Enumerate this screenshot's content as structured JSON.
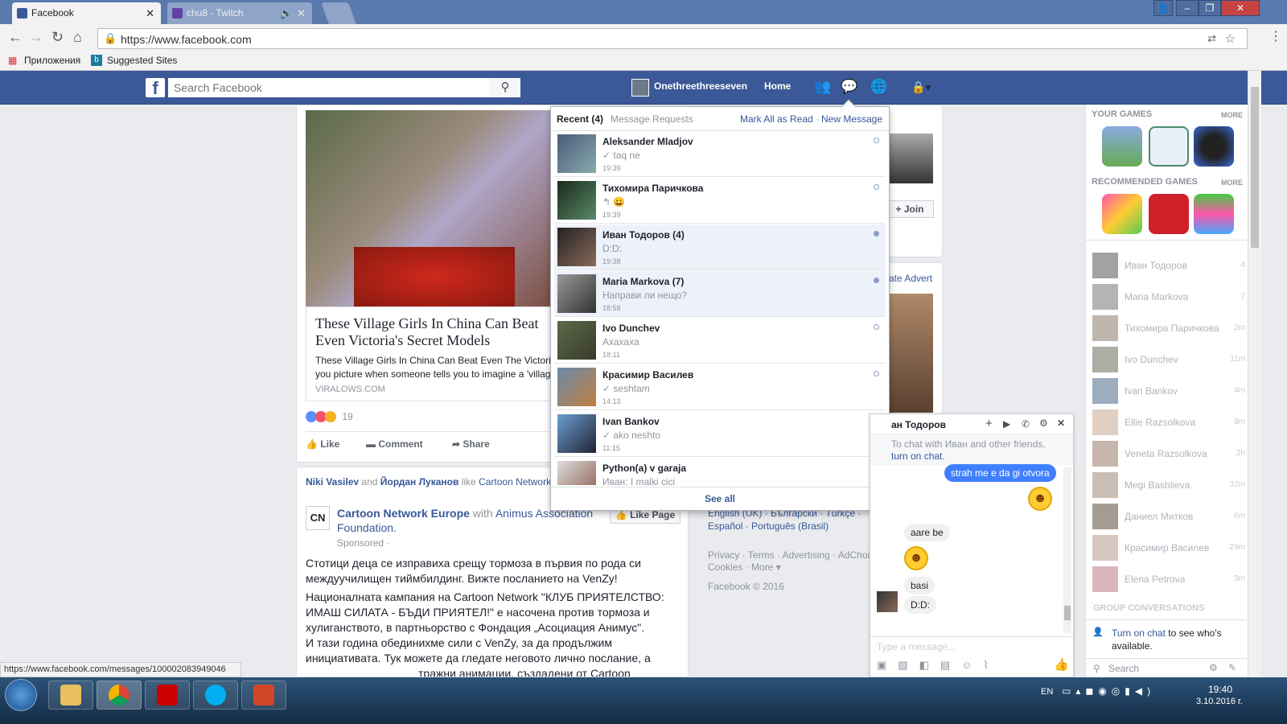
{
  "browser": {
    "tabs": [
      {
        "title": "Facebook",
        "active": true
      },
      {
        "title": "chu8 - Twitch",
        "active": false
      }
    ],
    "url": "https://www.facebook.com",
    "bookmarks": [
      "Приложения",
      "Suggested Sites"
    ],
    "status_url": "https://www.facebook.com/messages/100002083949046"
  },
  "fb_header": {
    "search_placeholder": "Search Facebook",
    "user_name": "Onethreethreeseven",
    "home": "Home"
  },
  "post1": {
    "title": "These Village Girls In China Can Beat Even Victoria's Secret Models",
    "desc_line1": "These Village Girls In China Can Beat Even The Victori",
    "desc_line2": "you picture when someone tells you to imagine a 'villag",
    "source": "VIRALOWS.COM",
    "reactions_count": "19",
    "actions": [
      "Like",
      "Comment",
      "Share"
    ]
  },
  "post2": {
    "liked_by_1": "Niki Vasilev",
    "liked_by_and": "and",
    "liked_by_2": "Йордан Луканов",
    "liked_by_rest": "like",
    "liked_page": "Cartoon Network",
    "page_name": "Cartoon Network Europe",
    "with_text": "with",
    "with_org": "Animus Association Foundation.",
    "sponsored": "Sponsored ·",
    "like_page": "Like Page",
    "text1": "Стотици деца се изправиха срещу тормоза в първия по рода си междуучилищен тиймбилдинг. Вижте посланието на VenZy!",
    "text2": "Националната кампания на Cartoon Network \"КЛУБ ПРИЯТЕЛСТВО: ИМАШ СИЛАТА - БЪДИ ПРИЯТЕЛ!\" е насочена против тормоза и хулиганството, в партньорство с Фондация „Асоциация Анимус\".",
    "text3": "И тази година обединихме сили с VenZy, за да продължим инициативата. Тук можете да гледате неговото лично послание, а",
    "text4": "тражни анимации, създадени от Cartoon Network,"
  },
  "right_feed": {
    "join": "+ Join",
    "create_advert": "ate Advert",
    "languages": "English (UK) · Български · Türkçe · Español · Português (Brasil)",
    "footer1": "Privacy · Terms · Advertising · AdChoi",
    "footer2": "Cookies · More ▾",
    "copyright": "Facebook © 2016"
  },
  "messages": {
    "tab_recent": "Recent (4)",
    "tab_requests": "Message Requests",
    "mark_read": "Mark All as Read",
    "sep": "·",
    "new_message": "New Message",
    "see_all": "See all",
    "threads": [
      {
        "name": "Aleksander Mladjov",
        "snippet": "✓ taq ne",
        "time": "19:39",
        "unread": false
      },
      {
        "name": "Тихомира Паричкова",
        "snippet": "↰ 😀",
        "time": "19:39",
        "unread": false
      },
      {
        "name": "Иван Тодоров (4)",
        "snippet": "D:D:",
        "time": "19:38",
        "unread": true
      },
      {
        "name": "Maria Markova (7)",
        "snippet": "Направи ли нещо?",
        "time": "18:58",
        "unread": true
      },
      {
        "name": "Ivo Dunchev",
        "snippet": "Ахахаха",
        "time": "18:11",
        "unread": false
      },
      {
        "name": "Красимир Василев",
        "snippet": "✓ seshtam",
        "time": "14:13",
        "unread": false
      },
      {
        "name": "Ivan Bankov",
        "snippet": "✓ ako neshto",
        "time": "11:15",
        "unread": false
      },
      {
        "name": "Python(a) v garaja",
        "snippet": "Иван: I malki cici",
        "time": "",
        "unread": false
      }
    ]
  },
  "sidebar": {
    "your_games": "YOUR GAMES",
    "more": "MORE",
    "recommended_games": "RECOMMENDED GAMES",
    "group_conversations": "GROUP CONVERSATIONS",
    "turn_on_chat": "Turn on chat",
    "turn_on_chat_rest": "to see who's available.",
    "search": "Search",
    "contacts": [
      {
        "name": "Иван Тодоров",
        "tag": "4"
      },
      {
        "name": "Maria Markova",
        "tag": "7"
      },
      {
        "name": "Тихомира Паричкова",
        "tag": "2m"
      },
      {
        "name": "Ivo Dunchev",
        "tag": "11m"
      },
      {
        "name": "Ivan Bankov",
        "tag": "4m"
      },
      {
        "name": "Ellie Razsolkova",
        "tag": "8m"
      },
      {
        "name": "Veneta Razsolkova",
        "tag": "2h"
      },
      {
        "name": "Megi Bashlieva",
        "tag": "32m"
      },
      {
        "name": "Даниел Митков",
        "tag": "6m"
      },
      {
        "name": "Красимир Василев",
        "tag": "29m"
      },
      {
        "name": "Elena Petrova",
        "tag": "3m"
      }
    ]
  },
  "chat": {
    "title": "ан Тодоров",
    "notice": "To chat with Иван and other friends,",
    "notice_link": "turn on chat.",
    "msg_sent": "strah me e da gi otvora",
    "msg1": "aare be",
    "msg2": "basi",
    "msg3": "D:D:",
    "placeholder": "Type a message..."
  },
  "taskbar": {
    "lang": "EN",
    "time": "19:40",
    "date": "3.10.2016 г."
  },
  "colors": {
    "fb_blue": "#3b5998",
    "link": "#365899"
  }
}
